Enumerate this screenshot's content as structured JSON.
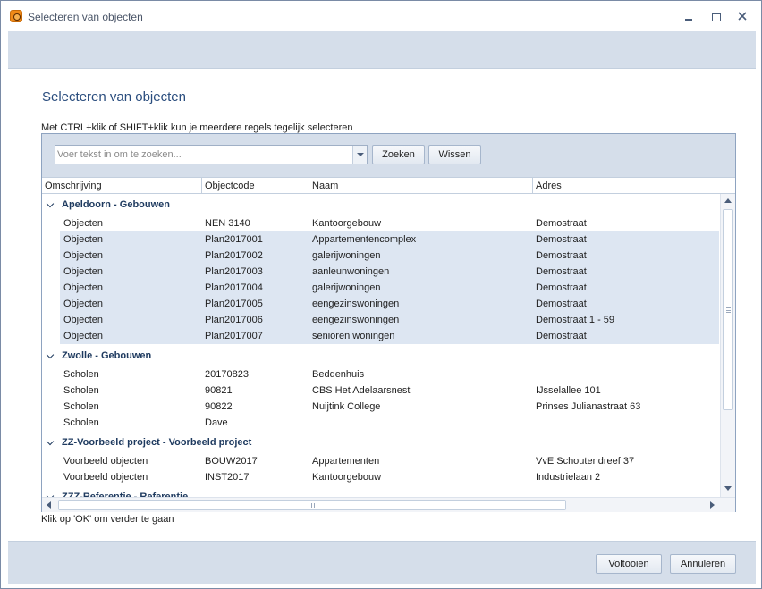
{
  "window": {
    "title": "Selecteren van objecten"
  },
  "main": {
    "heading": "Selecteren van objecten",
    "instruction": "Met CTRL+klik of SHIFT+klik kun je meerdere regels tegelijk selecteren",
    "footer_hint": "Klik op 'OK' om verder te gaan"
  },
  "search": {
    "placeholder": "Voer tekst in om te zoeken...",
    "search_label": "Zoeken",
    "clear_label": "Wissen"
  },
  "columns": [
    "Omschrijving",
    "Objectcode",
    "Naam",
    "Adres"
  ],
  "groups": [
    {
      "label": "Apeldoorn - Gebouwen",
      "rows": [
        {
          "omschrijving": "Objecten",
          "objectcode": "NEN 3140",
          "naam": "Kantoorgebouw",
          "adres": "Demostraat",
          "selected": false
        },
        {
          "omschrijving": "Objecten",
          "objectcode": "Plan2017001",
          "naam": "Appartementencomplex",
          "adres": "Demostraat",
          "selected": true
        },
        {
          "omschrijving": "Objecten",
          "objectcode": "Plan2017002",
          "naam": "galerijwoningen",
          "adres": "Demostraat",
          "selected": true
        },
        {
          "omschrijving": "Objecten",
          "objectcode": "Plan2017003",
          "naam": "aanleunwoningen",
          "adres": "Demostraat",
          "selected": true
        },
        {
          "omschrijving": "Objecten",
          "objectcode": "Plan2017004",
          "naam": "galerijwoningen",
          "adres": "Demostraat",
          "selected": true
        },
        {
          "omschrijving": "Objecten",
          "objectcode": "Plan2017005",
          "naam": "eengezinswoningen",
          "adres": "Demostraat",
          "selected": true
        },
        {
          "omschrijving": "Objecten",
          "objectcode": "Plan2017006",
          "naam": "eengezinswoningen",
          "adres": "Demostraat 1 - 59",
          "selected": true
        },
        {
          "omschrijving": "Objecten",
          "objectcode": "Plan2017007",
          "naam": "senioren woningen",
          "adres": "Demostraat",
          "selected": true
        }
      ]
    },
    {
      "label": "Zwolle - Gebouwen",
      "rows": [
        {
          "omschrijving": "Scholen",
          "objectcode": "20170823",
          "naam": "Beddenhuis",
          "adres": "",
          "selected": false
        },
        {
          "omschrijving": "Scholen",
          "objectcode": "90821",
          "naam": "CBS Het Adelaarsnest",
          "adres": "IJsselallee 101",
          "selected": false
        },
        {
          "omschrijving": "Scholen",
          "objectcode": "90822",
          "naam": "Nuijtink College",
          "adres": "Prinses Julianastraat 63",
          "selected": false
        },
        {
          "omschrijving": "Scholen",
          "objectcode": "Dave",
          "naam": "",
          "adres": "",
          "selected": false
        }
      ]
    },
    {
      "label": "ZZ-Voorbeeld project - Voorbeeld project",
      "rows": [
        {
          "omschrijving": "Voorbeeld objecten",
          "objectcode": "BOUW2017",
          "naam": "Appartementen",
          "adres": "VvE Schoutendreef 37",
          "selected": false
        },
        {
          "omschrijving": "Voorbeeld objecten",
          "objectcode": "INST2017",
          "naam": "Kantoorgebouw",
          "adres": "Industrielaan 2",
          "selected": false
        }
      ]
    },
    {
      "label": "ZZZ-Referentie - Referentie",
      "rows": []
    }
  ],
  "buttons": {
    "ok_label": "Voltooien",
    "cancel_label": "Annuleren"
  }
}
